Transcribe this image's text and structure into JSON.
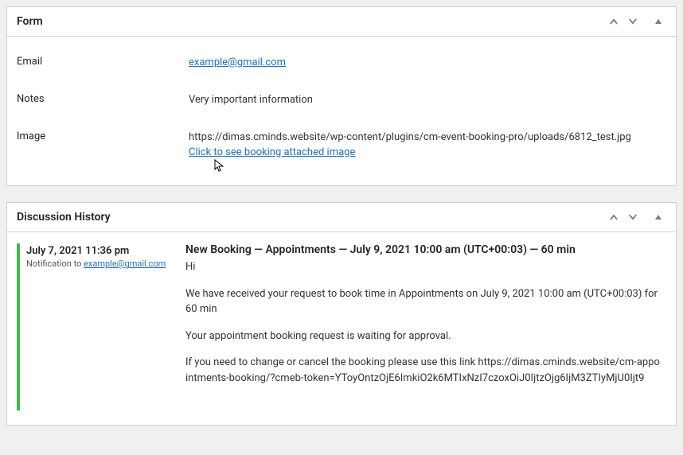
{
  "form_box": {
    "title": "Form",
    "rows": {
      "email": {
        "label": "Email",
        "value": "example@gmail.com"
      },
      "notes": {
        "label": "Notes",
        "value": "Very important information"
      },
      "image": {
        "label": "Image",
        "url": "https://dimas.cminds.website/wp-content/plugins/cm-event-booking-pro/uploads/6812_test.jpg",
        "link_text": "Click to see booking attached image"
      }
    }
  },
  "discussion_box": {
    "title": "Discussion History",
    "entry": {
      "date": "July 7, 2021 11:36 pm",
      "sub_prefix": "Notification to ",
      "sub_email": "example@gmail.com",
      "heading": "New Booking — Appointments — July 9, 2021 10:00 am (UTC+00:03) — 60 min",
      "p1": "Hi",
      "p2": "We have received your request to book time in Appointments on July 9, 2021 10:00 am (UTC+00:03) for 60 min",
      "p3": "Your appointment booking request is waiting for approval.",
      "p4": "If you need to change or cancel the booking please use this link https://dimas.cminds.website/cm-appointments-booking/?cmeb-token=YToyOntzOjE6ImkiO2k6MTIxNzI7czoxOiJ0IjtzOjg6IjM3ZTIyMjU0Ijt9"
    }
  }
}
